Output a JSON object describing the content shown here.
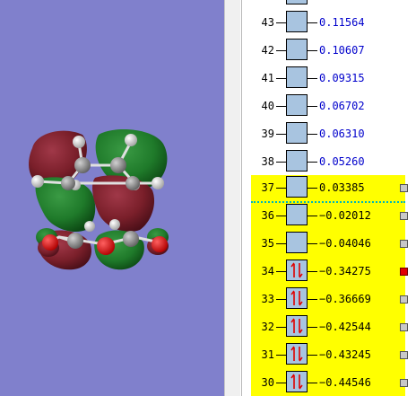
{
  "panel": {
    "orbitals": [
      {
        "index": "43",
        "energy": "0.11564",
        "occupied": false
      },
      {
        "index": "42",
        "energy": "0.10607",
        "occupied": false
      },
      {
        "index": "41",
        "energy": "0.09315",
        "occupied": false
      },
      {
        "index": "40",
        "energy": "0.06702",
        "occupied": false
      },
      {
        "index": "39",
        "energy": "0.06310",
        "occupied": false
      },
      {
        "index": "38",
        "energy": "0.05260",
        "occupied": false
      },
      {
        "index": "37",
        "energy": "0.03385",
        "occupied": false,
        "highlighted": true
      },
      {
        "index": "36",
        "energy": "−0.02012",
        "occupied": false,
        "highlighted": true
      },
      {
        "index": "35",
        "energy": "−0.04046",
        "occupied": false,
        "highlighted": true
      },
      {
        "index": "34",
        "energy": "−0.34275",
        "occupied": true,
        "selected": true
      },
      {
        "index": "33",
        "energy": "−0.36669",
        "occupied": true
      },
      {
        "index": "32",
        "energy": "−0.42544",
        "occupied": true
      },
      {
        "index": "31",
        "energy": "−0.43245",
        "occupied": true
      },
      {
        "index": "30",
        "energy": "−0.44546",
        "occupied": true
      }
    ]
  },
  "colors": {
    "background": "#8080cc",
    "lobe_positive": "#1f7a2a",
    "lobe_negative": "#7a1f2a",
    "occupied_row": "#ffff00",
    "selected_marker": "#e00000"
  }
}
